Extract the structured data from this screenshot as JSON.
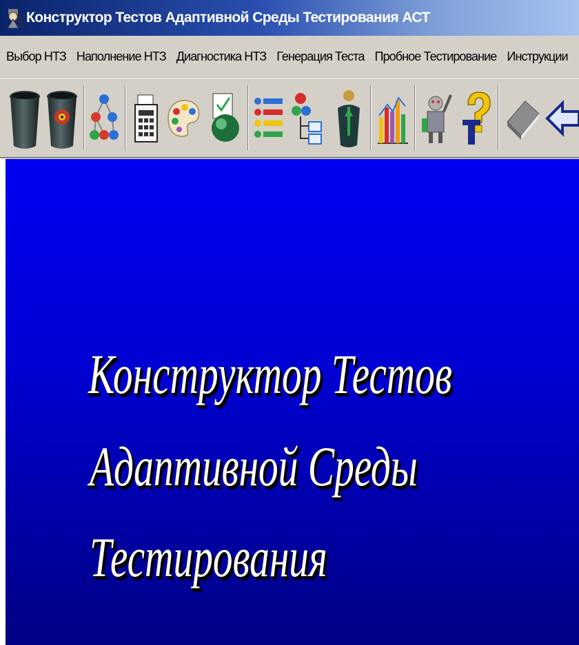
{
  "window": {
    "title": "Конструктор Тестов Адаптивной Среды Тестирования АСТ",
    "app_icon": "wizard-icon"
  },
  "menu": {
    "items": [
      {
        "label": "Выбор НТЗ"
      },
      {
        "label": "Наполнение НТЗ"
      },
      {
        "label": "Диагностика НТЗ"
      },
      {
        "label": "Генерация Теста"
      },
      {
        "label": "Пробное Тестирование"
      },
      {
        "label": "Инструкции"
      }
    ]
  },
  "toolbar": {
    "buttons": [
      {
        "icon": "trash-bin-icon"
      },
      {
        "icon": "trash-bin-disk-icon"
      },
      {
        "icon": "molecule-tree-icon"
      },
      {
        "icon": "calculator-document-icon"
      },
      {
        "icon": "palette-icon"
      },
      {
        "icon": "document-check-icon"
      },
      {
        "icon": "list-bullets-icon"
      },
      {
        "icon": "flowchart-icon"
      },
      {
        "icon": "person-award-icon"
      },
      {
        "icon": "bar-chart-icon"
      },
      {
        "icon": "robot-tools-icon"
      },
      {
        "icon": "help-question-icon"
      },
      {
        "icon": "book-icon"
      },
      {
        "icon": "back-arrow-icon"
      }
    ]
  },
  "main": {
    "heading_lines": [
      "Конструктор Тестов",
      "Адаптивной Среды",
      "Тестирования"
    ]
  },
  "colors": {
    "titlebar_start": "#0a246a",
    "titlebar_end": "#a6c3ee",
    "chrome": "#d4d0c8",
    "main_bg_top": "#0000f2",
    "main_bg_bottom": "#000084",
    "heading_text": "#ffffff"
  }
}
